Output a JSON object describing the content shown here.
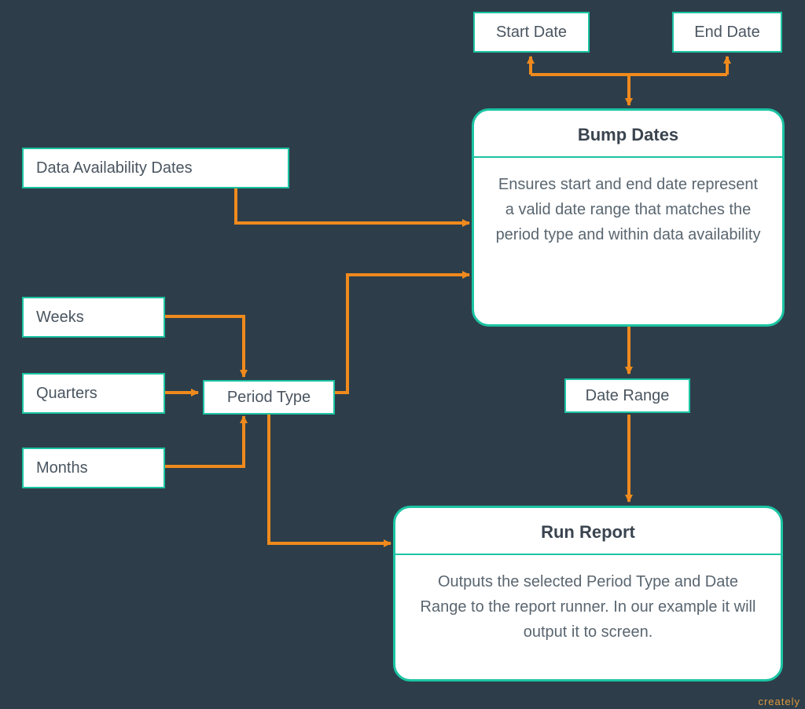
{
  "nodes": {
    "startDate": "Start Date",
    "endDate": "End Date",
    "dataAvail": "Data Availability Dates",
    "weeks": "Weeks",
    "quarters": "Quarters",
    "months": "Months",
    "periodType": "Period Type",
    "dateRange": "Date Range",
    "bumpDates": {
      "title": "Bump Dates",
      "body": "Ensures start and end date represent a valid date range that matches the period type and within data availability"
    },
    "runReport": {
      "title": "Run Report",
      "body": "Outputs the selected Period Type and Date Range to the report runner. In our example it will output it to screen."
    }
  },
  "watermark": "creately"
}
